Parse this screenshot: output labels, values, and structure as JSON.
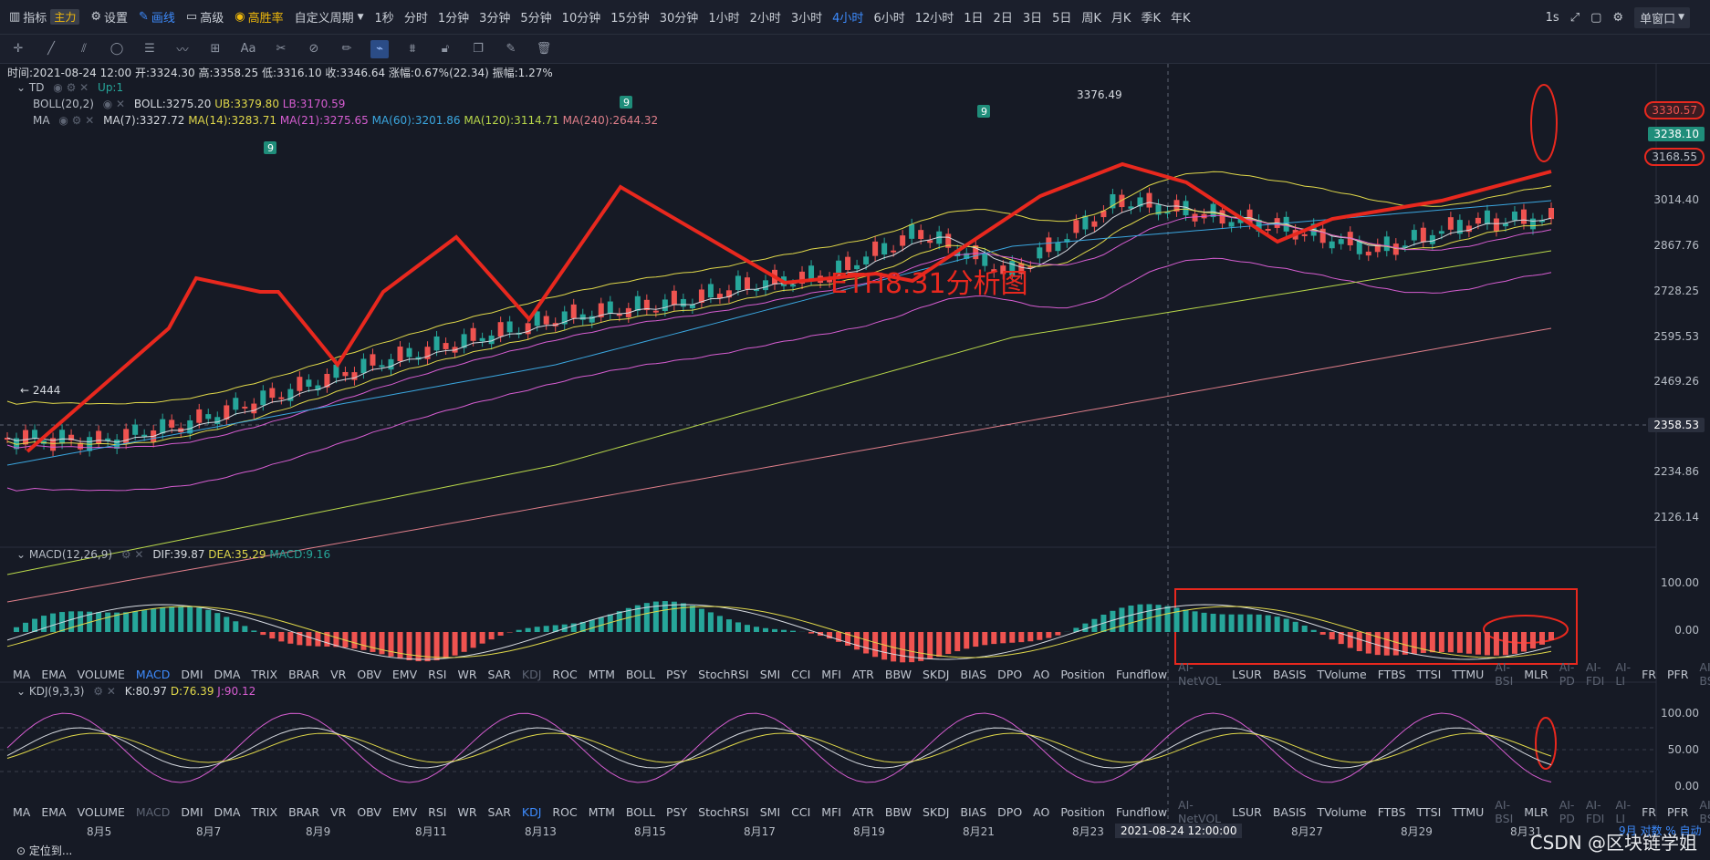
{
  "topbar": {
    "indicator": "指标",
    "main": "主力",
    "settings": "设置",
    "draw": "画线",
    "advanced": "高级",
    "winrate": "高胜率",
    "custom_period": "自定义周期",
    "periods": [
      "1秒",
      "分时",
      "1分钟",
      "3分钟",
      "5分钟",
      "10分钟",
      "15分钟",
      "30分钟",
      "1小时",
      "2小时",
      "3小时",
      "4小时",
      "6小时",
      "12小时",
      "1日",
      "2日",
      "3日",
      "5日",
      "周K",
      "月K",
      "季K",
      "年K"
    ],
    "active_period": "4小时",
    "right_interval": "1s",
    "window_mode": "单窗口"
  },
  "toolbar": {
    "icons": [
      "crosshair-icon",
      "trendline-icon",
      "channel-icon",
      "ellipse-icon",
      "fib-icon",
      "wave-icon",
      "measure-icon",
      "text-icon",
      "brush-icon",
      "eraser-icon",
      "pencil-icon",
      "magnet-icon",
      "pattern-icon",
      "lock-icon",
      "clone-icon",
      "template-icon",
      "trash-icon"
    ],
    "text_tool": "Aa"
  },
  "info": {
    "ohlc": "时间:2021-08-24 12:00  开:3324.30  高:3358.25  低:3316.10  收:3346.64  涨幅:0.67%(22.34)  振幅:1.27%",
    "td": "TD",
    "td_val": "Up:1",
    "boll": "BOLL(20,2)",
    "boll_ub": "UB:3379.80",
    "boll_lb": "LB:3170.59",
    "boll_mid": "BOLL:3275.20",
    "ma": "MA",
    "ma7": "MA(7):3327.72",
    "ma14": "MA(14):3283.71",
    "ma21": "MA(21):3275.65",
    "ma60": "MA(60):3201.86",
    "ma120": "MA(120):3114.71",
    "ma240": "MA(240):2644.32"
  },
  "annotations": {
    "title": "ETH8.31分析图",
    "hi_label": "3376.49",
    "lo_label": "← 2444",
    "td9": "9"
  },
  "price_axis": [
    "3014.40",
    "2867.76",
    "2728.25",
    "2595.53",
    "2469.26",
    "2234.86",
    "2126.14"
  ],
  "price_boxes": {
    "top": "3330.57",
    "cur": "3238.10",
    "low": "3168.55",
    "cross": "2358.53"
  },
  "macd": {
    "label": "MACD(12,26,9)",
    "dif": "DIF:39.87",
    "dea": "DEA:35.29",
    "macd": "MACD:9.16",
    "axis": [
      "100.00",
      "0.00"
    ]
  },
  "kdj": {
    "label": "KDJ(9,3,3)",
    "k": "K:80.97",
    "d": "D:76.39",
    "j": "J:90.12",
    "axis": [
      "100.00",
      "50.00",
      "0.00"
    ]
  },
  "indicators": [
    "MA",
    "EMA",
    "VOLUME",
    "MACD",
    "DMI",
    "DMA",
    "TRIX",
    "BRAR",
    "VR",
    "OBV",
    "EMV",
    "RSI",
    "WR",
    "SAR",
    "KDJ",
    "ROC",
    "MTM",
    "BOLL",
    "PSY",
    "StochRSI",
    "SMI",
    "CCI",
    "MFI",
    "ATR",
    "BBW",
    "SKDJ",
    "BIAS",
    "DPO",
    "AO",
    "Position",
    "Fundflow",
    "AI-NetVOL",
    "LSUR",
    "BASIS",
    "TVolume",
    "FTBS",
    "TTSI",
    "TTMU",
    "AI-BSI",
    "MLR",
    "AI-PD",
    "AI-FDI",
    "AI-LI",
    "FR",
    "PFR",
    "AI-BST"
  ],
  "dim_indicators": [
    "KDJ",
    "AI-NetVOL",
    "AI-BSI",
    "AI-PD",
    "AI-FDI",
    "AI-LI",
    "AI-BST"
  ],
  "dates": [
    "8月5",
    "8月7",
    "8月9",
    "8月11",
    "8月13",
    "8月15",
    "8月17",
    "8月19",
    "8月21",
    "8月23",
    "2021-08-24 12:00:00",
    "8月27",
    "8月29",
    "8月31"
  ],
  "footer": {
    "locate": "定位到...",
    "right": "9月 对数  %  自动",
    "watermark": "CSDN @区块链学姐"
  },
  "colors": {
    "up": "#26a69a",
    "down": "#ef5350",
    "accent": "#3d8bfd",
    "red_mark": "#e8281e"
  }
}
